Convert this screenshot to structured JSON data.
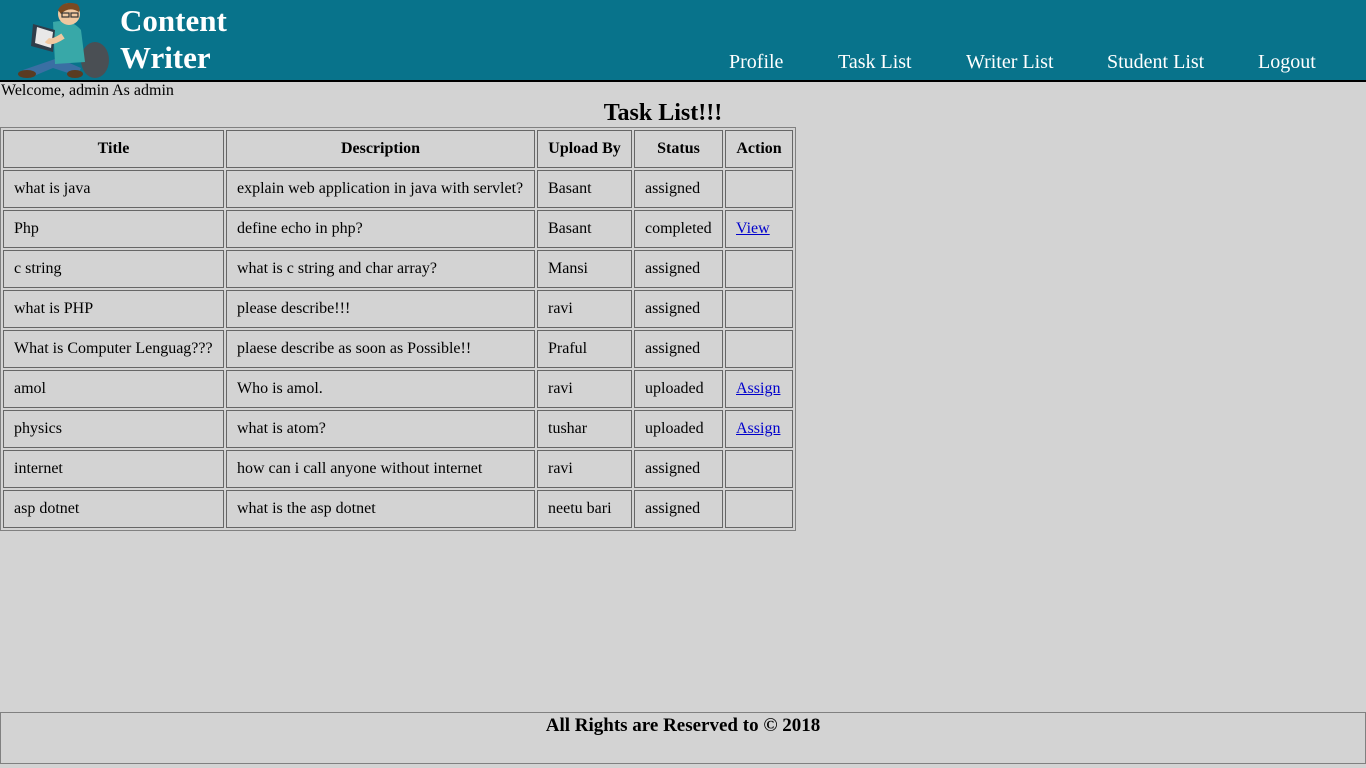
{
  "header": {
    "brand_line1": "Content",
    "brand_line2": "Writer",
    "nav": [
      "Profile",
      "Task List",
      "Writer List",
      "Student List",
      "Logout"
    ],
    "background": "#08738b"
  },
  "welcome": "Welcome, admin As admin",
  "page_title": "Task List!!!",
  "table": {
    "columns": [
      "Title",
      "Description",
      "Upload By",
      "Status",
      "Action"
    ],
    "rows": [
      {
        "title": "what is java",
        "description": "explain web application in java with servlet?",
        "upload_by": "Basant",
        "status": "assigned",
        "action": ""
      },
      {
        "title": "Php",
        "description": "define echo in php?",
        "upload_by": "Basant",
        "status": "completed",
        "action": "View"
      },
      {
        "title": "c string",
        "description": "what is c string and char array?",
        "upload_by": "Mansi",
        "status": "assigned",
        "action": ""
      },
      {
        "title": "what is PHP",
        "description": "please describe!!!",
        "upload_by": "ravi",
        "status": "assigned",
        "action": ""
      },
      {
        "title": "What is Computer Lenguag???",
        "description": "plaese describe as soon as Possible!!",
        "upload_by": "Praful",
        "status": "assigned",
        "action": ""
      },
      {
        "title": "amol",
        "description": "Who is amol.",
        "upload_by": "ravi",
        "status": "uploaded",
        "action": "Assign"
      },
      {
        "title": "physics",
        "description": "what is atom?",
        "upload_by": "tushar",
        "status": "uploaded",
        "action": "Assign"
      },
      {
        "title": "internet",
        "description": "how can i call anyone without internet",
        "upload_by": "ravi",
        "status": "assigned",
        "action": ""
      },
      {
        "title": "asp dotnet",
        "description": "what is the asp dotnet",
        "upload_by": "neetu bari",
        "status": "assigned",
        "action": ""
      }
    ]
  },
  "footer": "All Rights are Reserved to © 2018",
  "icons": {
    "logo": "reading-student-logo"
  }
}
